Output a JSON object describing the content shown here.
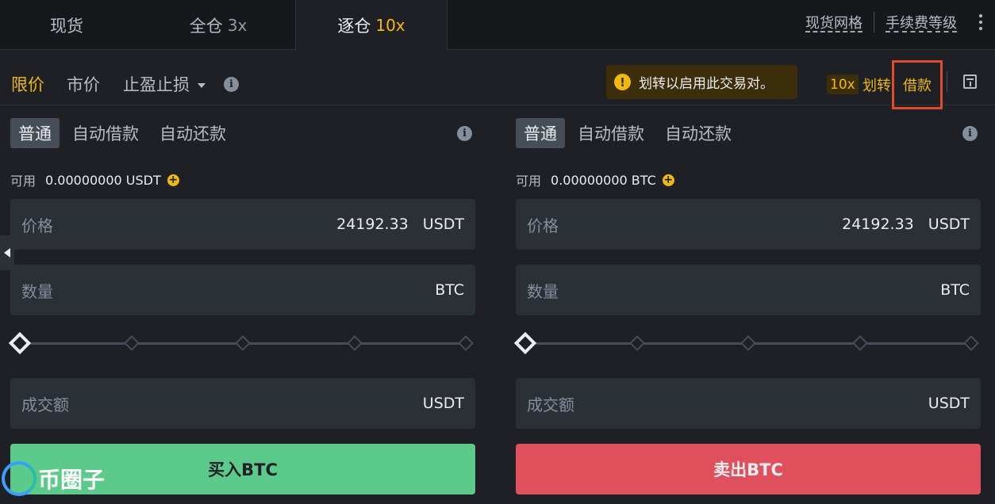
{
  "top_tabs": [
    {
      "label": "现货",
      "leverage": ""
    },
    {
      "label": "全仓",
      "leverage": "3x"
    },
    {
      "label": "逐仓",
      "leverage": "10x"
    }
  ],
  "top_links": {
    "grid": "现货网格",
    "fees": "手续费等级"
  },
  "order_types": {
    "limit": "限价",
    "market": "市价",
    "stop": "止盈止损"
  },
  "notice": "划转以启用此交易对。",
  "leverage_badge": "10x",
  "transfer_label": "划转",
  "borrow_label": "借款",
  "buy_panel": {
    "modes": [
      "普通",
      "自动借款",
      "自动还款"
    ],
    "available_label": "可用",
    "available_value": "0.00000000 USDT",
    "price_label": "价格",
    "price_value": "24192.33",
    "price_unit": "USDT",
    "amount_label": "数量",
    "amount_unit": "BTC",
    "slider_percent": 0,
    "total_label": "成交额",
    "total_unit": "USDT",
    "action_label": "买入BTC"
  },
  "sell_panel": {
    "modes": [
      "普通",
      "自动借款",
      "自动还款"
    ],
    "available_label": "可用",
    "available_value": "0.00000000 BTC",
    "price_label": "价格",
    "price_value": "24192.33",
    "price_unit": "USDT",
    "amount_label": "数量",
    "amount_unit": "BTC",
    "slider_percent": 0,
    "total_label": "成交额",
    "total_unit": "USDT",
    "action_label": "卖出BTC"
  },
  "watermark": "币圈子",
  "colors": {
    "accent": "#f0b90b",
    "buy": "#5cca8a",
    "sell": "#e0505c",
    "highlight_box": "#e04a2d"
  }
}
